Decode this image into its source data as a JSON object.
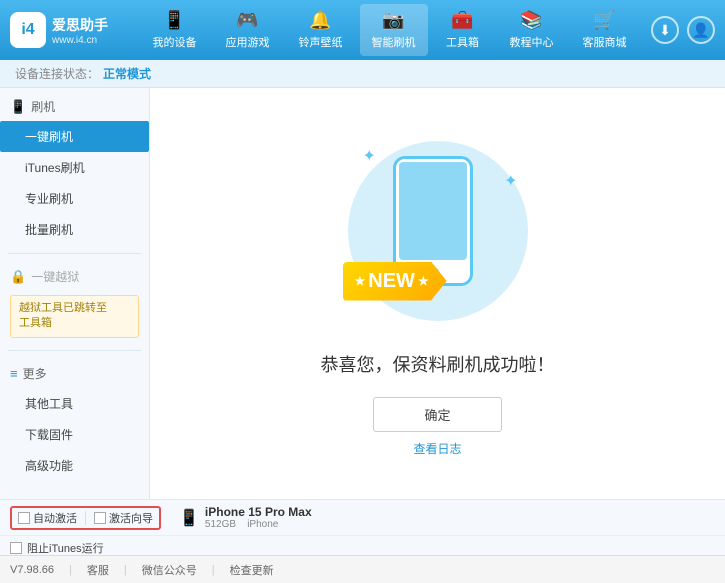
{
  "app": {
    "logo_char": "i4",
    "logo_name": "爱思助手",
    "logo_url": "www.i4.cn",
    "win_controls": [
      "—",
      "□",
      "✕"
    ]
  },
  "nav": {
    "items": [
      {
        "icon": "📱",
        "label": "我的设备"
      },
      {
        "icon": "🎮",
        "label": "应用游戏"
      },
      {
        "icon": "🔔",
        "label": "铃声壁纸"
      },
      {
        "icon": "📷",
        "label": "智能刷机"
      },
      {
        "icon": "🧰",
        "label": "工具箱"
      },
      {
        "icon": "📚",
        "label": "教程中心"
      },
      {
        "icon": "🛒",
        "label": "客服商城"
      }
    ]
  },
  "status_bar": {
    "prefix": "设备连接状态：",
    "value": "正常模式"
  },
  "sidebar": {
    "sections": [
      {
        "icon": "📱",
        "label": "刷机",
        "items": [
          {
            "label": "一键刷机",
            "active": true
          },
          {
            "label": "iTunes刷机",
            "active": false
          },
          {
            "label": "专业刷机",
            "active": false
          },
          {
            "label": "批量刷机",
            "active": false
          }
        ]
      },
      {
        "icon": "🔑",
        "label": "一键越狱",
        "disabled": true,
        "items": []
      },
      {
        "notice": "越狱工具已跳转至\n工具箱"
      },
      {
        "icon": "≡",
        "label": "更多",
        "items": [
          {
            "label": "其他工具"
          },
          {
            "label": "下载固件"
          },
          {
            "label": "高级功能"
          }
        ]
      }
    ]
  },
  "main": {
    "illustration": {
      "new_label": "NEW",
      "stars": [
        "✦",
        "✦",
        "✦"
      ]
    },
    "success_text": "恭喜您，保资料刷机成功啦！",
    "confirm_btn": "确定",
    "log_link": "查看日志"
  },
  "device_bar": {
    "auto_activate_label": "自动激活",
    "activate_guide_label": "激活向导",
    "device_name": "iPhone 15 Pro Max",
    "device_storage": "512GB",
    "device_type": "iPhone",
    "itunes_label": "阻止iTunes运行"
  },
  "footer": {
    "version": "V7.98.66",
    "items": [
      {
        "label": "客服"
      },
      {
        "label": "微信公众号"
      },
      {
        "label": "检查更新"
      }
    ]
  }
}
